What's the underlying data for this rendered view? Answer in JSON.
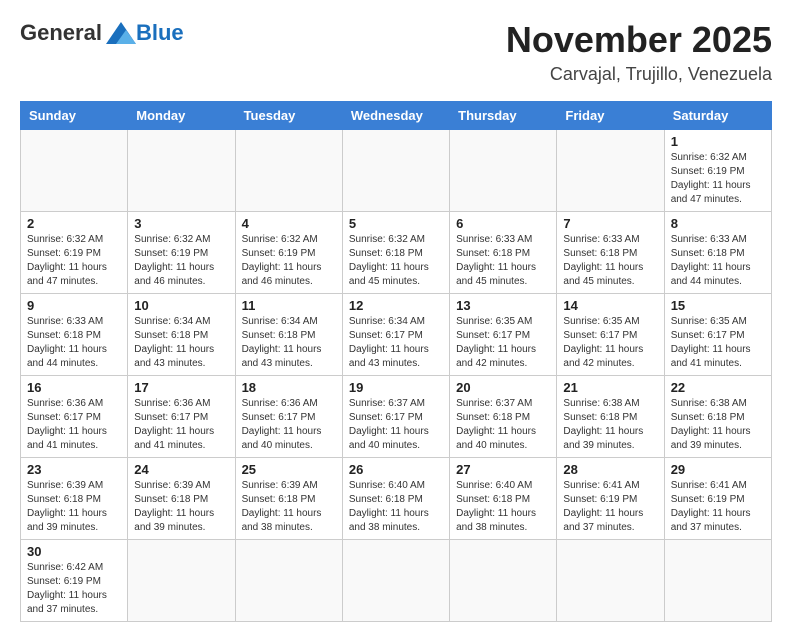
{
  "header": {
    "logo_general": "General",
    "logo_blue": "Blue",
    "month_title": "November 2025",
    "location": "Carvajal, Trujillo, Venezuela"
  },
  "weekdays": [
    "Sunday",
    "Monday",
    "Tuesday",
    "Wednesday",
    "Thursday",
    "Friday",
    "Saturday"
  ],
  "rows": [
    [
      {
        "day": "",
        "info": ""
      },
      {
        "day": "",
        "info": ""
      },
      {
        "day": "",
        "info": ""
      },
      {
        "day": "",
        "info": ""
      },
      {
        "day": "",
        "info": ""
      },
      {
        "day": "",
        "info": ""
      },
      {
        "day": "1",
        "info": "Sunrise: 6:32 AM\nSunset: 6:19 PM\nDaylight: 11 hours\nand 47 minutes."
      }
    ],
    [
      {
        "day": "2",
        "info": "Sunrise: 6:32 AM\nSunset: 6:19 PM\nDaylight: 11 hours\nand 47 minutes."
      },
      {
        "day": "3",
        "info": "Sunrise: 6:32 AM\nSunset: 6:19 PM\nDaylight: 11 hours\nand 46 minutes."
      },
      {
        "day": "4",
        "info": "Sunrise: 6:32 AM\nSunset: 6:19 PM\nDaylight: 11 hours\nand 46 minutes."
      },
      {
        "day": "5",
        "info": "Sunrise: 6:32 AM\nSunset: 6:18 PM\nDaylight: 11 hours\nand 45 minutes."
      },
      {
        "day": "6",
        "info": "Sunrise: 6:33 AM\nSunset: 6:18 PM\nDaylight: 11 hours\nand 45 minutes."
      },
      {
        "day": "7",
        "info": "Sunrise: 6:33 AM\nSunset: 6:18 PM\nDaylight: 11 hours\nand 45 minutes."
      },
      {
        "day": "8",
        "info": "Sunrise: 6:33 AM\nSunset: 6:18 PM\nDaylight: 11 hours\nand 44 minutes."
      }
    ],
    [
      {
        "day": "9",
        "info": "Sunrise: 6:33 AM\nSunset: 6:18 PM\nDaylight: 11 hours\nand 44 minutes."
      },
      {
        "day": "10",
        "info": "Sunrise: 6:34 AM\nSunset: 6:18 PM\nDaylight: 11 hours\nand 43 minutes."
      },
      {
        "day": "11",
        "info": "Sunrise: 6:34 AM\nSunset: 6:18 PM\nDaylight: 11 hours\nand 43 minutes."
      },
      {
        "day": "12",
        "info": "Sunrise: 6:34 AM\nSunset: 6:17 PM\nDaylight: 11 hours\nand 43 minutes."
      },
      {
        "day": "13",
        "info": "Sunrise: 6:35 AM\nSunset: 6:17 PM\nDaylight: 11 hours\nand 42 minutes."
      },
      {
        "day": "14",
        "info": "Sunrise: 6:35 AM\nSunset: 6:17 PM\nDaylight: 11 hours\nand 42 minutes."
      },
      {
        "day": "15",
        "info": "Sunrise: 6:35 AM\nSunset: 6:17 PM\nDaylight: 11 hours\nand 41 minutes."
      }
    ],
    [
      {
        "day": "16",
        "info": "Sunrise: 6:36 AM\nSunset: 6:17 PM\nDaylight: 11 hours\nand 41 minutes."
      },
      {
        "day": "17",
        "info": "Sunrise: 6:36 AM\nSunset: 6:17 PM\nDaylight: 11 hours\nand 41 minutes."
      },
      {
        "day": "18",
        "info": "Sunrise: 6:36 AM\nSunset: 6:17 PM\nDaylight: 11 hours\nand 40 minutes."
      },
      {
        "day": "19",
        "info": "Sunrise: 6:37 AM\nSunset: 6:17 PM\nDaylight: 11 hours\nand 40 minutes."
      },
      {
        "day": "20",
        "info": "Sunrise: 6:37 AM\nSunset: 6:18 PM\nDaylight: 11 hours\nand 40 minutes."
      },
      {
        "day": "21",
        "info": "Sunrise: 6:38 AM\nSunset: 6:18 PM\nDaylight: 11 hours\nand 39 minutes."
      },
      {
        "day": "22",
        "info": "Sunrise: 6:38 AM\nSunset: 6:18 PM\nDaylight: 11 hours\nand 39 minutes."
      }
    ],
    [
      {
        "day": "23",
        "info": "Sunrise: 6:39 AM\nSunset: 6:18 PM\nDaylight: 11 hours\nand 39 minutes."
      },
      {
        "day": "24",
        "info": "Sunrise: 6:39 AM\nSunset: 6:18 PM\nDaylight: 11 hours\nand 39 minutes."
      },
      {
        "day": "25",
        "info": "Sunrise: 6:39 AM\nSunset: 6:18 PM\nDaylight: 11 hours\nand 38 minutes."
      },
      {
        "day": "26",
        "info": "Sunrise: 6:40 AM\nSunset: 6:18 PM\nDaylight: 11 hours\nand 38 minutes."
      },
      {
        "day": "27",
        "info": "Sunrise: 6:40 AM\nSunset: 6:18 PM\nDaylight: 11 hours\nand 38 minutes."
      },
      {
        "day": "28",
        "info": "Sunrise: 6:41 AM\nSunset: 6:19 PM\nDaylight: 11 hours\nand 37 minutes."
      },
      {
        "day": "29",
        "info": "Sunrise: 6:41 AM\nSunset: 6:19 PM\nDaylight: 11 hours\nand 37 minutes."
      }
    ],
    [
      {
        "day": "30",
        "info": "Sunrise: 6:42 AM\nSunset: 6:19 PM\nDaylight: 11 hours\nand 37 minutes."
      },
      {
        "day": "",
        "info": ""
      },
      {
        "day": "",
        "info": ""
      },
      {
        "day": "",
        "info": ""
      },
      {
        "day": "",
        "info": ""
      },
      {
        "day": "",
        "info": ""
      },
      {
        "day": "",
        "info": ""
      }
    ]
  ]
}
